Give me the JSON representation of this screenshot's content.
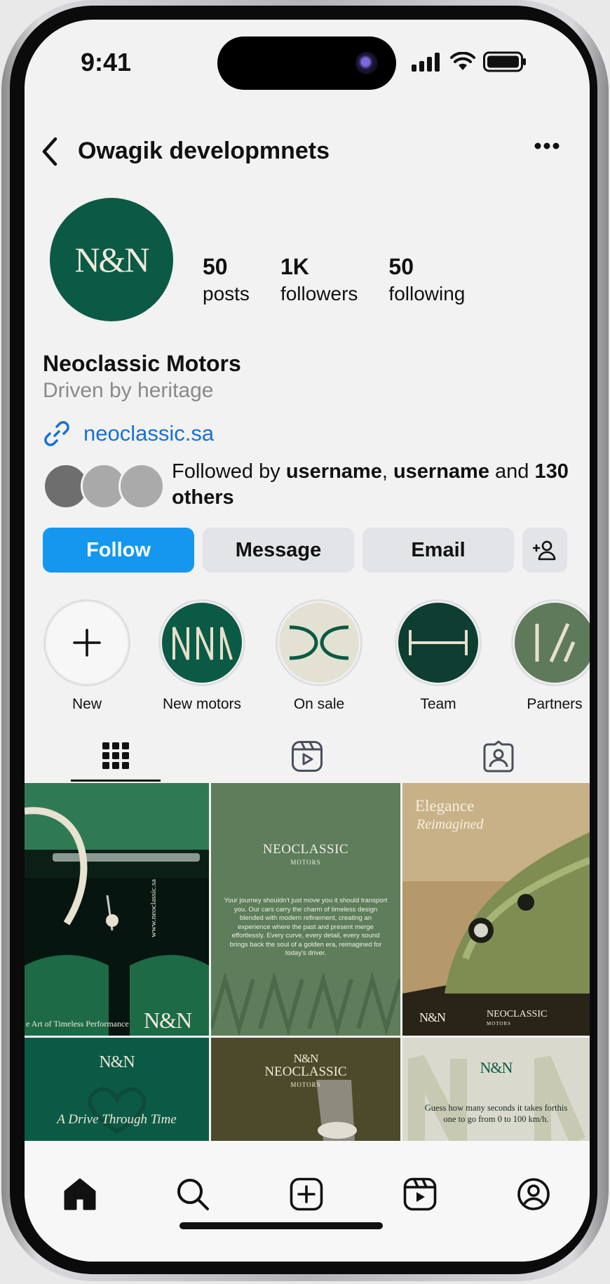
{
  "status": {
    "time": "9:41"
  },
  "header": {
    "handle": "Owagik developmnets"
  },
  "profile": {
    "logo_text": "N&N",
    "stats": [
      {
        "value": "50",
        "label": "posts"
      },
      {
        "value": "1K",
        "label": "followers"
      },
      {
        "value": "50",
        "label": "following"
      }
    ],
    "name": "Neoclassic Motors",
    "bio": "Driven by heritage",
    "link": "neoclassic.sa",
    "followed": {
      "prefix": "Followed by ",
      "user1": "username",
      "sep": ", ",
      "user2": "username",
      "mid": " and ",
      "count": "130",
      "suffix": " others"
    }
  },
  "actions": {
    "follow": "Follow",
    "message": "Message",
    "email": "Email"
  },
  "highlights": [
    {
      "label": "New"
    },
    {
      "label": "New motors"
    },
    {
      "label": "On sale"
    },
    {
      "label": "Team"
    },
    {
      "label": "Partners"
    }
  ],
  "posts": {
    "p1": {
      "tagline": "e Art of Timeless Performance",
      "logo": "N&N",
      "url": "www.neoclassic.sa"
    },
    "p2": {
      "title": "NEOCLASSIC",
      "subtitle": "MOTORS",
      "body": "Your journey shouldn't just move you it should transport you. Our cars carry the charm of timeless design blended with modern refinement, creating an experience where the past and present merge effortlessly. Every curve, every detail, every sound brings back the soul of a golden era, reimagined for today's driver."
    },
    "p3": {
      "title": "Elegance",
      "subtitle": "Reimagined",
      "brand": "NEOCLASSIC",
      "brand_sub": "MOTORS",
      "logo": "N&N"
    },
    "p4": {
      "logo": "N&N",
      "tagline": "A Drive Through Time"
    },
    "p5": {
      "logo": "N&N",
      "title": "NEOCLASSIC",
      "subtitle": "MOTORS"
    },
    "p6": {
      "logo": "N&N",
      "text": "Guess how many seconds it takes forthis one to go from 0 to 100 km/h."
    }
  },
  "colors": {
    "brand_green": "#0b5a45",
    "follow_blue": "#1597f0",
    "link_blue": "#1672d6"
  }
}
